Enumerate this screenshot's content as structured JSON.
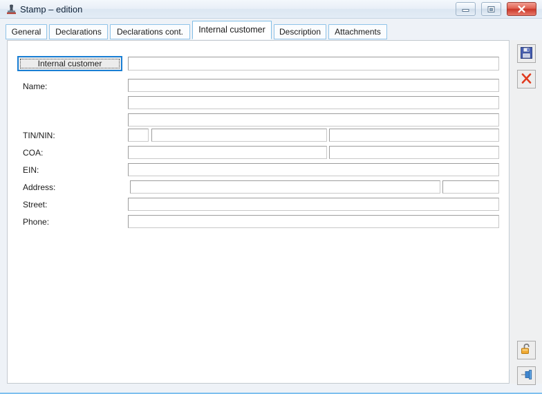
{
  "window": {
    "title": "Stamp – edition",
    "icon": "stamp-icon",
    "controls": {
      "minimize": "–",
      "restore": "❐",
      "close": "✕"
    }
  },
  "tabs": [
    {
      "label": "General",
      "active": false
    },
    {
      "label": "Declarations",
      "active": false
    },
    {
      "label": "Declarations cont.",
      "active": false
    },
    {
      "label": "Internal customer",
      "active": true
    },
    {
      "label": "Description",
      "active": false
    },
    {
      "label": "Attachments",
      "active": false
    }
  ],
  "form": {
    "internal_customer_button": "Internal customer",
    "internal_customer_value": "",
    "rows": [
      {
        "label": "Name:",
        "value": ""
      },
      {
        "label": "",
        "value": ""
      },
      {
        "label": "",
        "value": ""
      },
      {
        "label": "TIN/NIN:",
        "value": "",
        "value2": "",
        "value3": ""
      },
      {
        "label": "COA:",
        "value": "",
        "value2": ""
      },
      {
        "label": "EIN:",
        "value": ""
      },
      {
        "label": "Address:",
        "value": "",
        "value2": ""
      },
      {
        "label": "Street:",
        "value": ""
      },
      {
        "label": "Phone:",
        "value": ""
      }
    ]
  },
  "toolbar": {
    "save": "save-icon",
    "cancel": "cancel-icon",
    "lock": "unlock-icon",
    "pin": "pin-icon"
  },
  "colors": {
    "accent": "#7ec0ee",
    "tab_border": "#8fc3e8",
    "focus": "#1a7fd4",
    "close_button": "#c9372a"
  }
}
